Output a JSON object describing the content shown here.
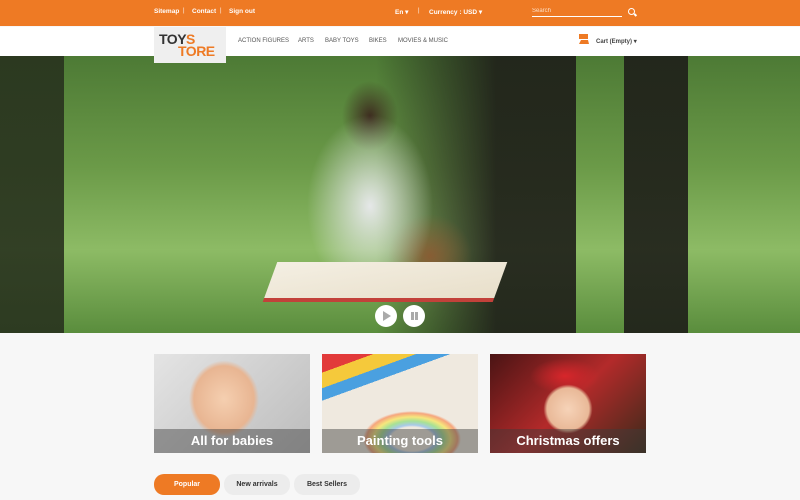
{
  "topbar": {
    "links": [
      "Sitemap",
      "Contact",
      "Sign out"
    ],
    "language": "En",
    "currency": "Currency : USD",
    "search_placeholder": "Search"
  },
  "logo": {
    "part1": "TOY",
    "part1_accent": "S",
    "part2": "TORE"
  },
  "nav": [
    "ACTION FIGURES",
    "ARTS",
    "BABY TOYS",
    "BIKES",
    "MOVIES & MUSIC"
  ],
  "cart": {
    "label": "Cart (Empty)"
  },
  "banners": [
    "All for babies",
    "Painting tools",
    "Christmas offers"
  ],
  "tabs": [
    "Popular",
    "New arrivals",
    "Best Sellers"
  ],
  "colors": {
    "accent": "#ee7a24"
  }
}
